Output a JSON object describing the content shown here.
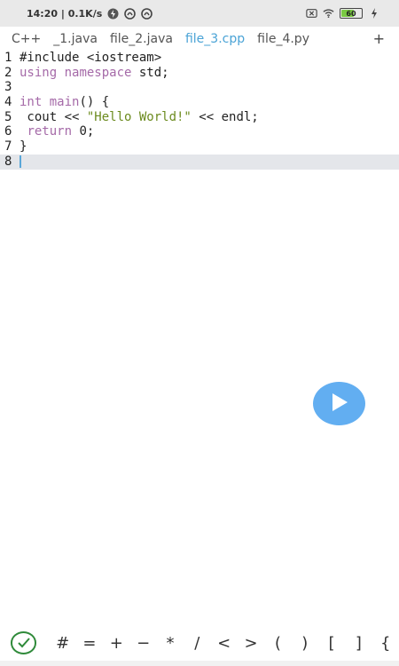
{
  "status": {
    "time_speed": "14:20 | 0.1K/s",
    "battery": "60",
    "battery_level": 0.6,
    "icons": [
      "bolt-notification-icon",
      "app-notification-icon",
      "app-notification-icon",
      "sim-off-icon",
      "wifi-icon",
      "battery-icon",
      "charging-icon"
    ]
  },
  "tabs": [
    {
      "label": "C++"
    },
    {
      "label": "_1.java"
    },
    {
      "label": "file_2.java"
    },
    {
      "label": "file_3.cpp",
      "active": true
    },
    {
      "label": "file_4.py"
    }
  ],
  "tabs_add": "+",
  "editor": {
    "lines": [
      {
        "n": "1",
        "parts": [
          {
            "t": "#include <iostream>",
            "c": "code"
          }
        ]
      },
      {
        "n": "2",
        "parts": [
          {
            "t": "using",
            "c": "kw"
          },
          {
            "t": " ",
            "c": "code"
          },
          {
            "t": "namespace",
            "c": "kw2"
          },
          {
            "t": " std;",
            "c": "code"
          }
        ]
      },
      {
        "n": "3",
        "parts": []
      },
      {
        "n": "4",
        "parts": [
          {
            "t": "int",
            "c": "kw"
          },
          {
            "t": " ",
            "c": "code"
          },
          {
            "t": "main",
            "c": "kw2"
          },
          {
            "t": "() {",
            "c": "code"
          }
        ]
      },
      {
        "n": "5",
        "parts": [
          {
            "t": " cout << ",
            "c": "code"
          },
          {
            "t": "\"Hello World!\"",
            "c": "str"
          },
          {
            "t": " << endl;",
            "c": "code"
          }
        ]
      },
      {
        "n": "6",
        "parts": [
          {
            "t": " ",
            "c": "code"
          },
          {
            "t": "return",
            "c": "kw"
          },
          {
            "t": " 0;",
            "c": "code"
          }
        ]
      },
      {
        "n": "7",
        "parts": [
          {
            "t": "}",
            "c": "code"
          }
        ]
      },
      {
        "n": "8",
        "parts": [],
        "current": true
      }
    ]
  },
  "symbols": [
    "#",
    "=",
    "+",
    "−",
    "*",
    "/",
    "<",
    ">",
    "(",
    ")",
    "[",
    "]",
    "{"
  ],
  "colors": {
    "accent": "#4aa3d6",
    "fab": "#62aef1",
    "check": "#2f8a3a",
    "keyword": "#a56aa8",
    "string": "#6c8b1f"
  }
}
